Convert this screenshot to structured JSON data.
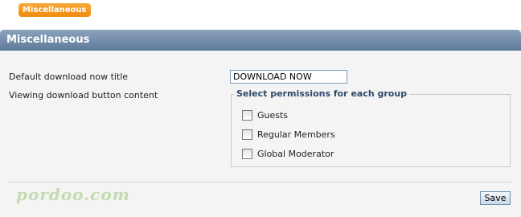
{
  "tab": {
    "label": "Miscellaneous"
  },
  "panel": {
    "title": "Miscellaneous"
  },
  "form": {
    "download_title_label": "Default download now title",
    "download_title_value": "DOWNLOAD NOW",
    "button_content_label": "Viewing download button content"
  },
  "permissions": {
    "legend": "Select permissions for each group",
    "groups": [
      {
        "label": "Guests",
        "checked": false
      },
      {
        "label": "Regular Members",
        "checked": false
      },
      {
        "label": "Global Moderator",
        "checked": false
      }
    ]
  },
  "watermark": "pordoo.com",
  "actions": {
    "save_label": "Save"
  }
}
